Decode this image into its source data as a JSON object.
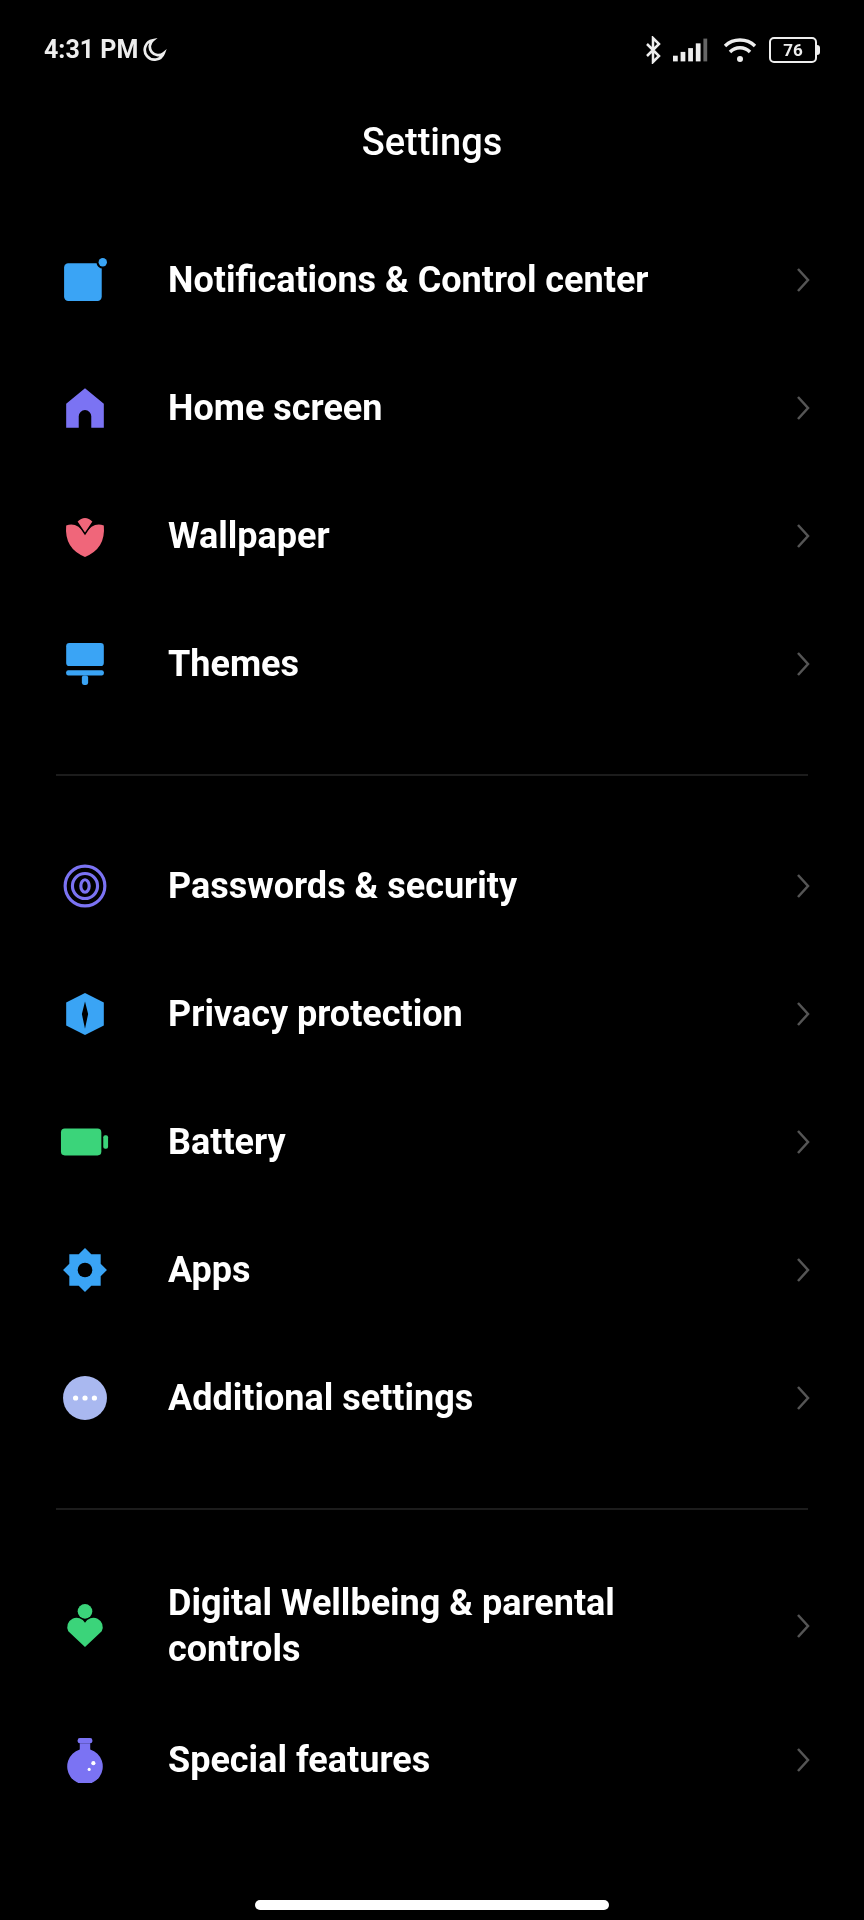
{
  "status_bar": {
    "time": "4:31 PM",
    "battery": "76"
  },
  "title": "Settings",
  "sections": [
    {
      "items": [
        {
          "label": "Notifications & Control center"
        },
        {
          "label": "Home screen"
        },
        {
          "label": "Wallpaper"
        },
        {
          "label": "Themes"
        }
      ]
    },
    {
      "items": [
        {
          "label": "Passwords & security"
        },
        {
          "label": "Privacy protection"
        },
        {
          "label": "Battery"
        },
        {
          "label": "Apps"
        },
        {
          "label": "Additional settings"
        }
      ]
    },
    {
      "items": [
        {
          "label": "Digital Wellbeing & parental controls"
        },
        {
          "label": "Special features"
        }
      ]
    }
  ]
}
